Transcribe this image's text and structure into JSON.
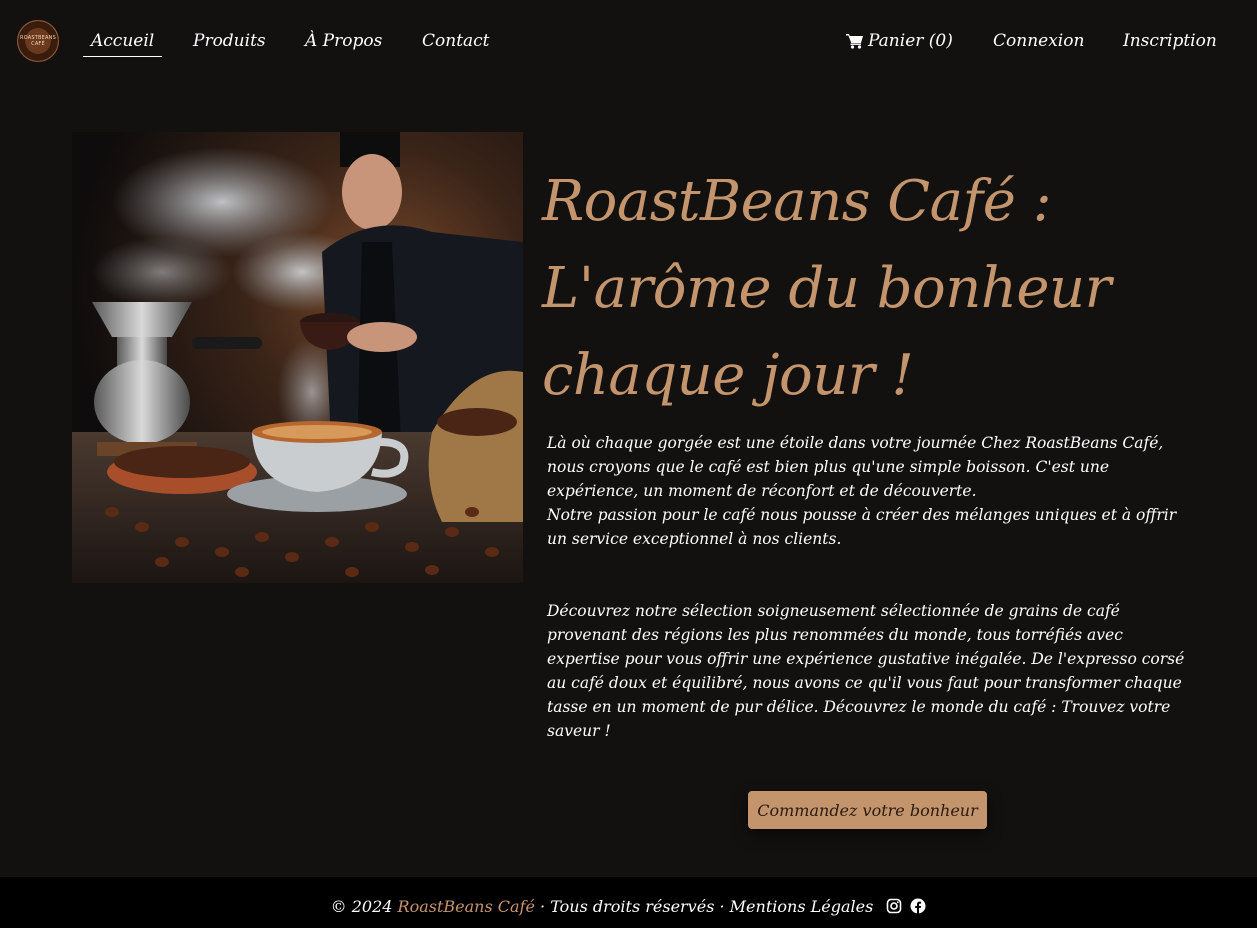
{
  "brand": {
    "logo_text": "ROASTBEANS CAFÉ",
    "accent_color": "#c4956d",
    "background_color": "#121110"
  },
  "nav": {
    "items": [
      {
        "label": "Accueil",
        "active": true
      },
      {
        "label": "Produits"
      },
      {
        "label": "À Propos"
      },
      {
        "label": "Contact"
      }
    ],
    "cart_label": "Panier (0)",
    "cart_icon": "shopping-cart-icon",
    "login_label": "Connexion",
    "signup_label": "Inscription"
  },
  "hero": {
    "title_line1": "RoastBeans Café :",
    "title_line2": "L'arôme du bonheur",
    "title_line3": "chaque jour !",
    "intro_p1": "Là où chaque gorgée est une étoile dans votre journée Chez RoastBeans Café, nous croyons que le café est bien plus qu'une simple boisson. C'est une expérience, un moment de réconfort et de découverte.",
    "intro_p2": "Notre passion pour le café nous pousse à créer des mélanges uniques et à offrir un service exceptionnel à nos clients.",
    "selection": "Découvrez notre sélection soigneusement sélectionnée de grains de café provenant des régions les plus renommées du monde, tous torréfiés avec expertise pour vous offrir une expérience gustative inégalée. De l'expresso corsé au café doux et équilibré, nous avons ce qu'il vous faut pour transformer chaque tasse en un moment de pur délice. Découvrez le monde du café : Trouvez votre saveur !",
    "cta_label": "Commandez votre bonheur"
  },
  "footer": {
    "copyright": "© 2024",
    "brand": "RoastBeans Café",
    "rights": "· Tous droits réservés",
    "legal": "· Mentions Légales",
    "social_icons": [
      "instagram-icon",
      "facebook-icon"
    ]
  }
}
